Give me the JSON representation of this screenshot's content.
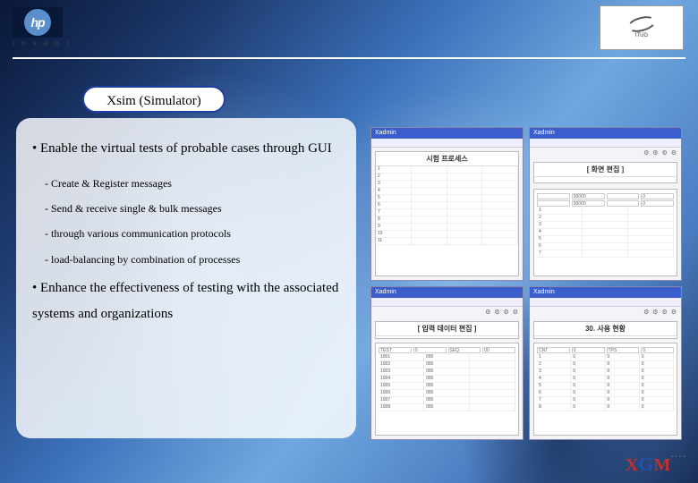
{
  "hp": {
    "text": "hp",
    "tagline": "i n v e n t"
  },
  "itug": {
    "tag": "ITUG"
  },
  "title": "Xsim (Simulator)",
  "bullets": [
    "Enable the virtual tests of  probable cases through GUI",
    "Enhance the effectiveness of testing with the associated systems and organizations"
  ],
  "sub": [
    "- Create & Register messages",
    "- Send & receive single & bulk  messages",
    "- through various communication protocols",
    "- load-balancing by combination of processes"
  ],
  "shots": {
    "tl": {
      "title": "Xadmin",
      "panel": "시험 프로세스"
    },
    "tr": {
      "title": "Xadmin",
      "panel": "[ 화면 편집 ]"
    },
    "bl": {
      "title": "Xadmin",
      "panel": "[ 입력 데이터 편집 ]"
    },
    "br": {
      "title": "Xadmin",
      "panel": "30. 사용 현황"
    }
  },
  "xgm": {
    "x": "X",
    "g": "G",
    "m": "M",
    "dots": "· · · ·"
  }
}
